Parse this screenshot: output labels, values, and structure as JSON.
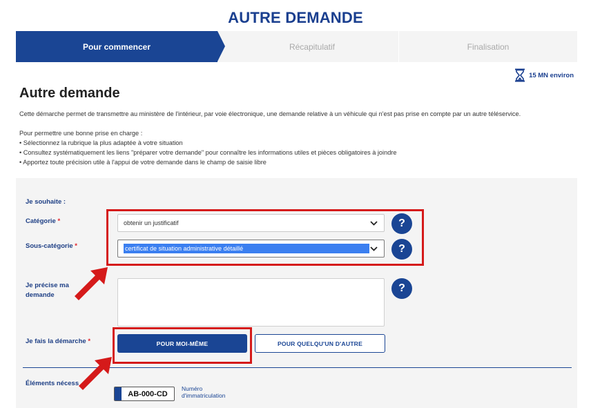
{
  "page": {
    "heading": "AUTRE DEMANDE"
  },
  "steps": [
    {
      "label": "Pour commencer",
      "active": true
    },
    {
      "label": "Récapitulatif",
      "active": false
    },
    {
      "label": "Finalisation",
      "active": false
    }
  ],
  "duration": {
    "icon": "hourglass-icon",
    "label": "15 MN environ"
  },
  "main": {
    "title": "Autre demande",
    "intro": "Cette démarche permet de transmettre au ministère de l'intérieur, par voie électronique, une demande relative à un véhicule qui n'est pas prise en compte par un autre téléservice.",
    "guidance_title": "Pour permettre une bonne prise en charge :",
    "guidance_items": [
      "• Sélectionnez la rubrique la plus adaptée à votre situation",
      "• Consultez systématiquement les liens \"préparer votre demande\" pour connaître les informations utiles et pièces obligatoires à joindre",
      "• Apportez toute précision utile à l'appui de votre demande dans le champ de saisie libre"
    ]
  },
  "form": {
    "intro_label": "Je souhaite :",
    "category": {
      "label": "Catégorie",
      "required_mark": "*",
      "value": "obtenir un justificatif"
    },
    "subcategory": {
      "label": "Sous-catégorie",
      "required_mark": "*",
      "value": "certificat de situation administrative détaillé"
    },
    "details": {
      "label_line1": "Je précise ma",
      "label_line2": "demande",
      "value": ""
    },
    "for_whom": {
      "label": "Je fais la démarche",
      "required_mark": "*",
      "self_button": "POUR MOI-MÊME",
      "other_button": "POUR QUELQU'UN D'AUTRE"
    },
    "help_symbol": "?",
    "elements_label": "Éléments nécess",
    "plate": {
      "value": "AB-000-CD",
      "caption_line1": "Numéro",
      "caption_line2": "d'immatriculation"
    }
  },
  "colors": {
    "brand_blue": "#1a4594",
    "title_blue": "#1a3f8f",
    "annotation_red": "#d51a1a",
    "panel_bg": "#f4f4f4",
    "selection_blue": "#3b7ff0"
  }
}
